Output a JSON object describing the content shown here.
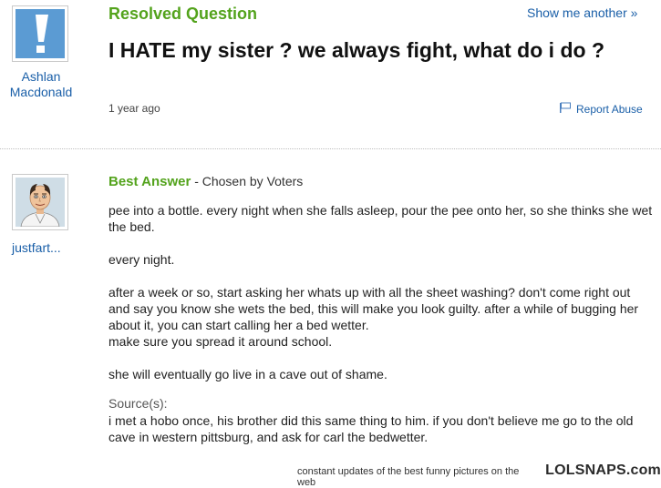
{
  "question": {
    "status_label": "Resolved Question",
    "title": "I HATE my sister ? we always fight, what do i do ?",
    "asker": {
      "name_line1": "Ashlan",
      "name_line2": "Macdonald"
    },
    "time_ago": "1 year ago",
    "report_label": "Report Abuse",
    "show_another_label": "Show me another »"
  },
  "answer": {
    "best_answer_label": "Best Answer",
    "chosen_by": " - Chosen by Voters",
    "answerer_name": "justfart...",
    "paragraphs": [
      "pee into a bottle. every night when she falls asleep, pour the pee onto her, so she thinks she wet the bed.",
      "every night.",
      "after a week or so, start asking her whats up with all the sheet washing? don't come right out and say you know she wets the bed, this will make you look guilty. after a while of bugging her about it, you can start calling her a bed wetter.",
      "make sure you spread it around school.",
      "she will eventually go live in a cave out of shame."
    ],
    "sources_label": "Source(s):",
    "sources_text": "i met a hobo once, his brother did this same thing to him. if you don't believe me go to the old cave in western pittsburg, and ask for carl the bedwetter."
  },
  "footer": {
    "tagline": "constant updates of the best funny pictures on the web",
    "brand": "LOLSNAPS.com"
  },
  "colors": {
    "green": "#53a31c",
    "link_blue": "#1a5fa8",
    "avatar_blue": "#5b9bd3"
  }
}
